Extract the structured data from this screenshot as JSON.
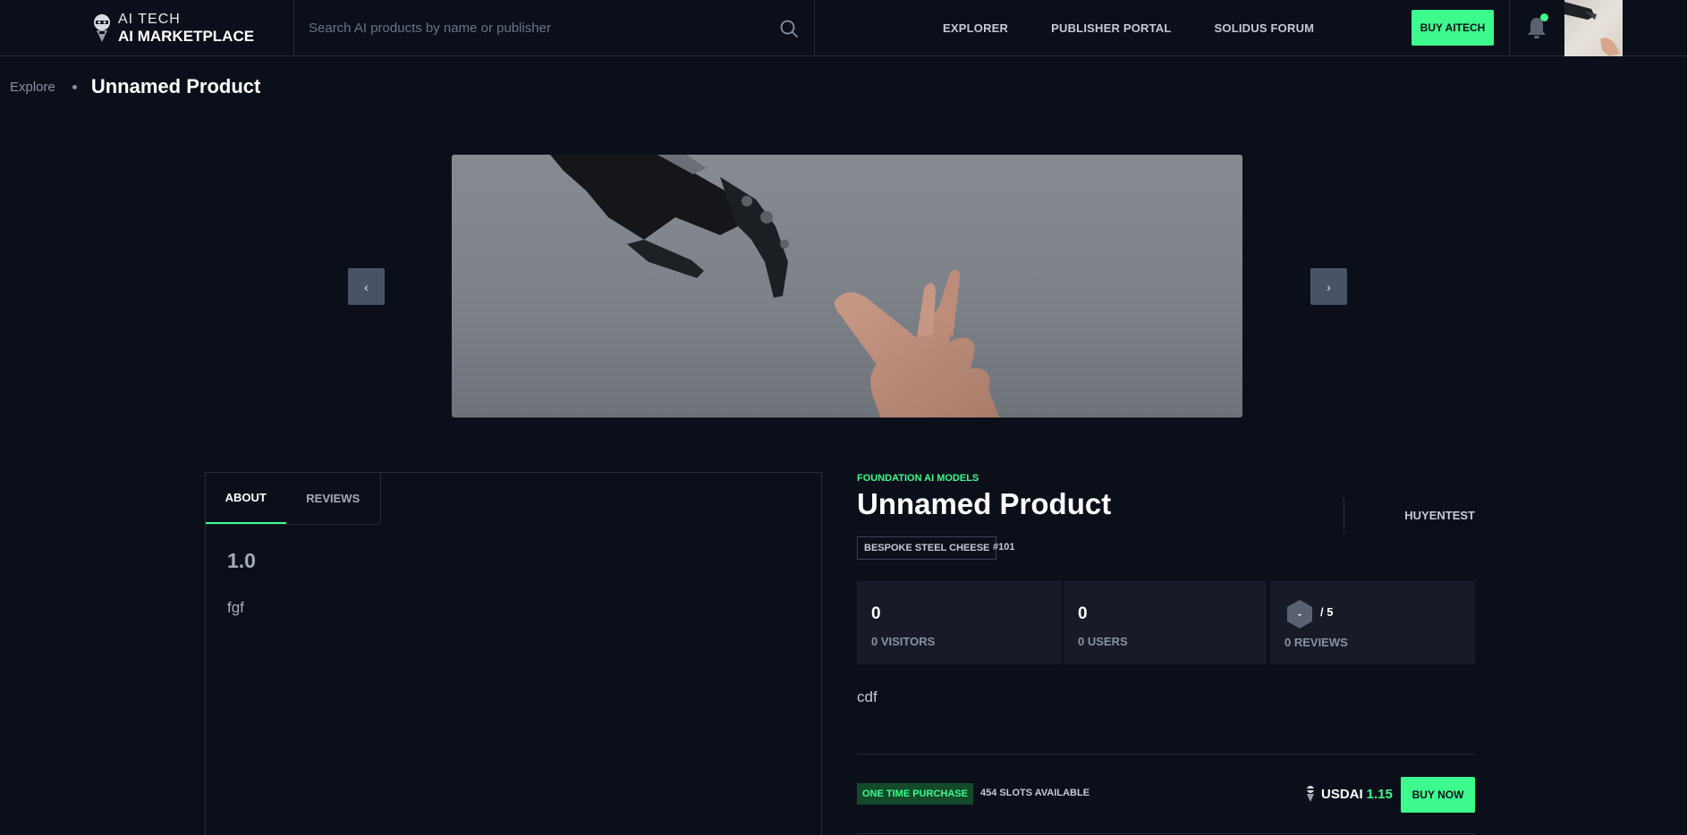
{
  "header": {
    "logo_line1": "AI TECH",
    "logo_line2": "AI MARKETPLACE",
    "search_placeholder": "Search AI products by name or publisher",
    "nav": [
      "EXPLORER",
      "PUBLISHER PORTAL",
      "SOLIDUS FORUM"
    ],
    "buy_label": "BUY AITECH",
    "notification_dot": true,
    "icons": {
      "search": "search-icon",
      "bell": "bell-icon",
      "avatar": "user-avatar"
    }
  },
  "breadcrumb": {
    "parent": "Explore",
    "current": "Unnamed Product"
  },
  "carousel": {
    "prev_label": "‹",
    "next_label": "›",
    "image": "robot hand reaching human hand"
  },
  "tabs": {
    "about": "ABOUT",
    "reviews": "REVIEWS",
    "active": "ABOUT"
  },
  "about": {
    "version": "1.0",
    "text": "fgf"
  },
  "product": {
    "category": "FOUNDATION AI MODELS",
    "title": "Unnamed Product",
    "publisher": "HUYENTEST",
    "tag": "BESPOKE STEEL CHEESE",
    "number": "#101",
    "description": "cdf"
  },
  "stats": {
    "visitors_count": "0",
    "visitors_label": "0 VISITORS",
    "users_count": "0",
    "users_label": "0 USERS",
    "rating_value": "-",
    "rating_outof": "/ 5",
    "reviews_label": "0 REVIEWS"
  },
  "purchase": {
    "type": "ONE TIME PURCHASE",
    "slots": "454 SLOTS AVAILABLE",
    "currency": "USDAI",
    "price": "1.15",
    "buy_label": "BUY NOW"
  },
  "colors": {
    "background": "#0b0f1a",
    "accent": "#3dfb8d",
    "panel": "#161b27",
    "border": "#262c38"
  }
}
